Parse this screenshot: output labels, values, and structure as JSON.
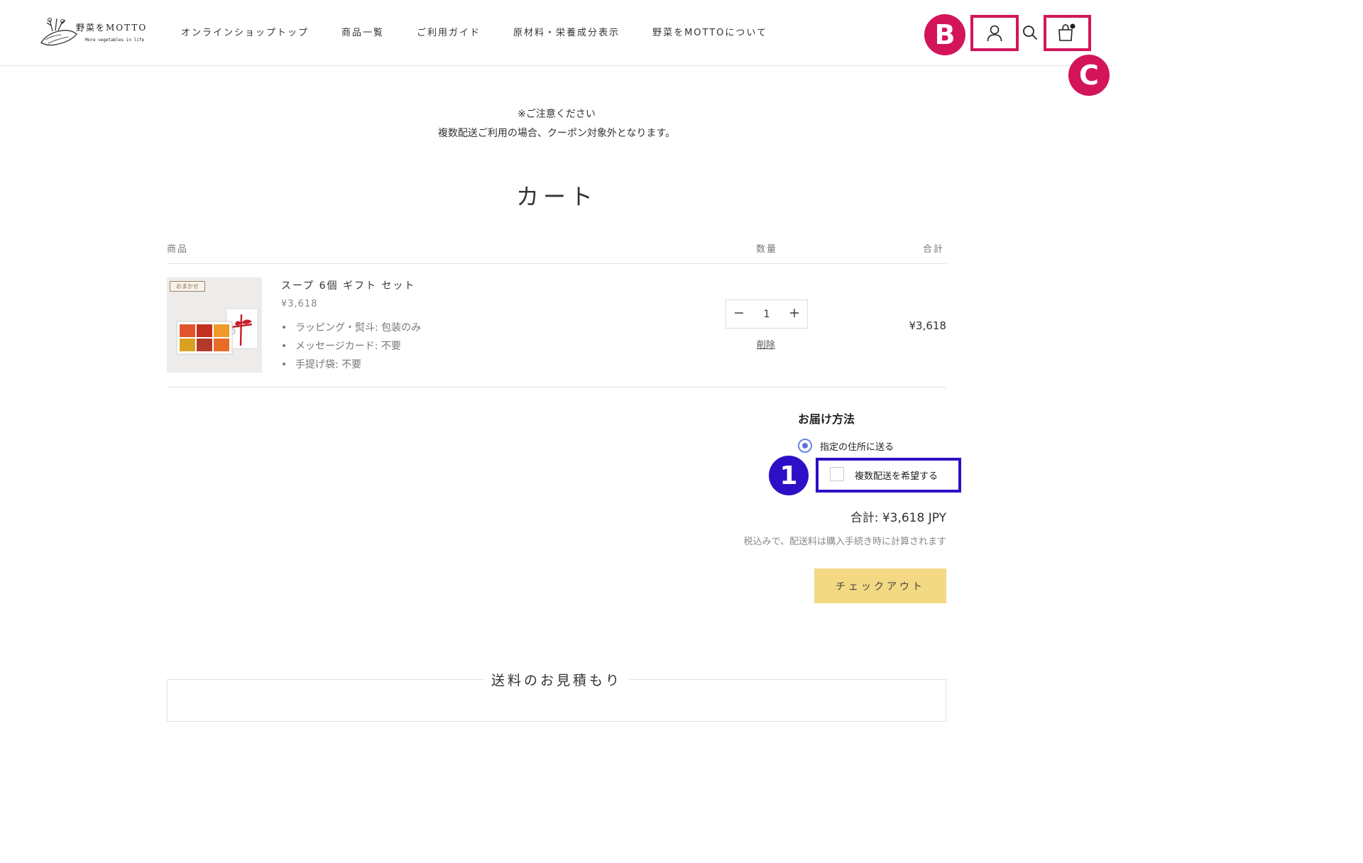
{
  "header": {
    "logo": {
      "text": "野菜をMOTTO",
      "subtitle": "More vegetables in life"
    },
    "nav": [
      "オンラインショップトップ",
      "商品一覧",
      "ご利用ガイド",
      "原材料・栄養成分表示",
      "野菜をMOTTOについて"
    ],
    "icons": [
      "account-icon",
      "search-icon",
      "cart-icon"
    ]
  },
  "annotations": {
    "b": "B",
    "c": "C",
    "step": "1"
  },
  "notice": {
    "line1": "※ご注意ください",
    "line2": "複数配送ご利用の場合、クーポン対象外となります。"
  },
  "cart": {
    "title": "カート",
    "headers": {
      "product": "商品",
      "quantity": "数量",
      "total": "合計"
    },
    "item": {
      "tag": "おまかせ",
      "name": "スープ 6個 ギフト セット",
      "price": "¥3,618",
      "options": [
        "ラッピング・熨斗: 包装のみ",
        "メッセージカード: 不要",
        "手提げ袋: 不要"
      ],
      "quantity": "1",
      "remove_label": "削除",
      "line_total": "¥3,618"
    }
  },
  "delivery": {
    "title": "お届け方法",
    "option_single": "指定の住所に送る",
    "option_multiple": "複数配送を希望する",
    "single_selected": true,
    "multiple_checked": false
  },
  "summary": {
    "subtotal": "合計: ¥3,618 JPY",
    "tax_note": "税込みで、配送料は購入手続き時に計算されます",
    "checkout_label": "チェックアウト"
  },
  "shipping_estimate": {
    "title": "送料のお見積もり"
  },
  "colors": {
    "highlight_pink": "#d4145a",
    "highlight_blue": "#2c10c7",
    "checkout_yellow": "#f3d983",
    "radio_blue": "#5b74e0"
  }
}
